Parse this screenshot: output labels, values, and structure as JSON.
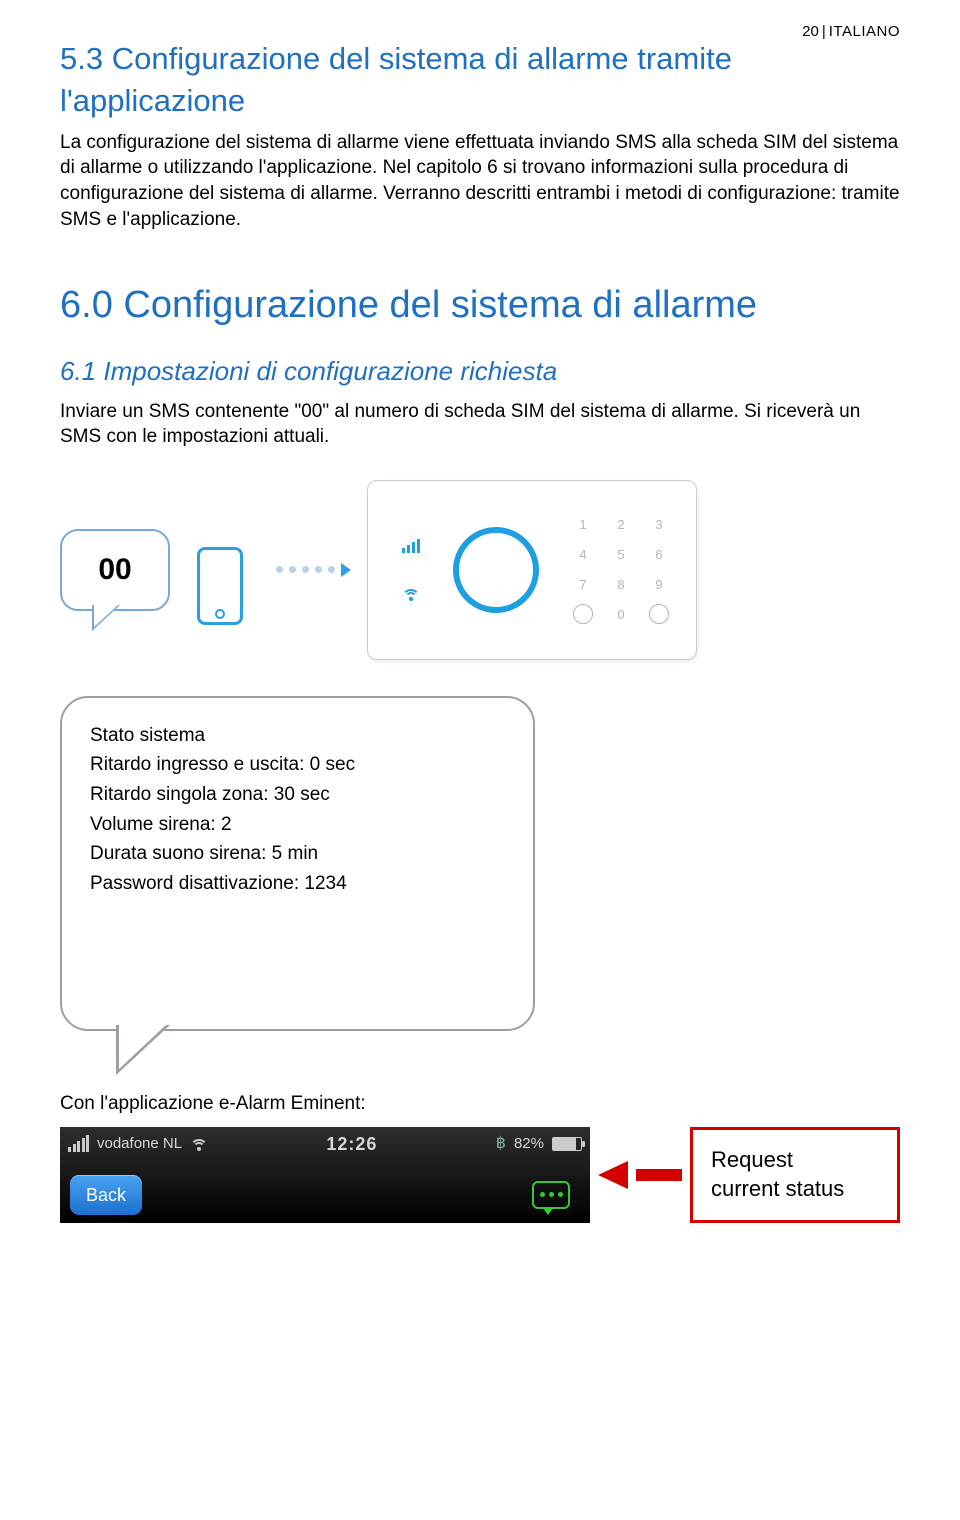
{
  "page": {
    "number": "20",
    "language": "ITALIANO"
  },
  "section53": {
    "title": "5.3 Configurazione del sistema di allarme tramite l'applicazione",
    "body": "La configurazione del sistema di allarme viene effettuata inviando SMS alla scheda SIM del sistema di allarme o utilizzando l'applicazione. Nel capitolo 6 si trovano informazioni sulla procedura di configurazione del sistema di allarme. Verranno descritti entrambi i metodi di configurazione: tramite SMS e l'applicazione."
  },
  "chapter6": {
    "title": "6.0 Configurazione del sistema di allarme"
  },
  "section61": {
    "title": "6.1 Impostazioni di configurazione richiesta",
    "body": "Inviare un SMS contenente \"00\" al numero di scheda SIM del sistema di allarme. Si riceverà un SMS con le impostazioni attuali."
  },
  "sms_code": "00",
  "keypad": [
    "1",
    "2",
    "3",
    "4",
    "5",
    "6",
    "7",
    "8",
    "9",
    "",
    "0",
    ""
  ],
  "status_reply": {
    "heading": "Stato sistema",
    "lines": [
      "Ritardo ingresso e uscita: 0 sec",
      "Ritardo singola zona: 30 sec",
      "Volume sirena: 2",
      "Durata suono sirena: 5 min",
      "Password disattivazione: 1234"
    ]
  },
  "app_intro": "Con l'applicazione e-Alarm Eminent:",
  "statusbar": {
    "carrier": "vodafone NL",
    "time": "12:26",
    "battery_pct": "82%",
    "back_label": "Back"
  },
  "request_box": {
    "l1": "Request",
    "l2": "current status"
  }
}
